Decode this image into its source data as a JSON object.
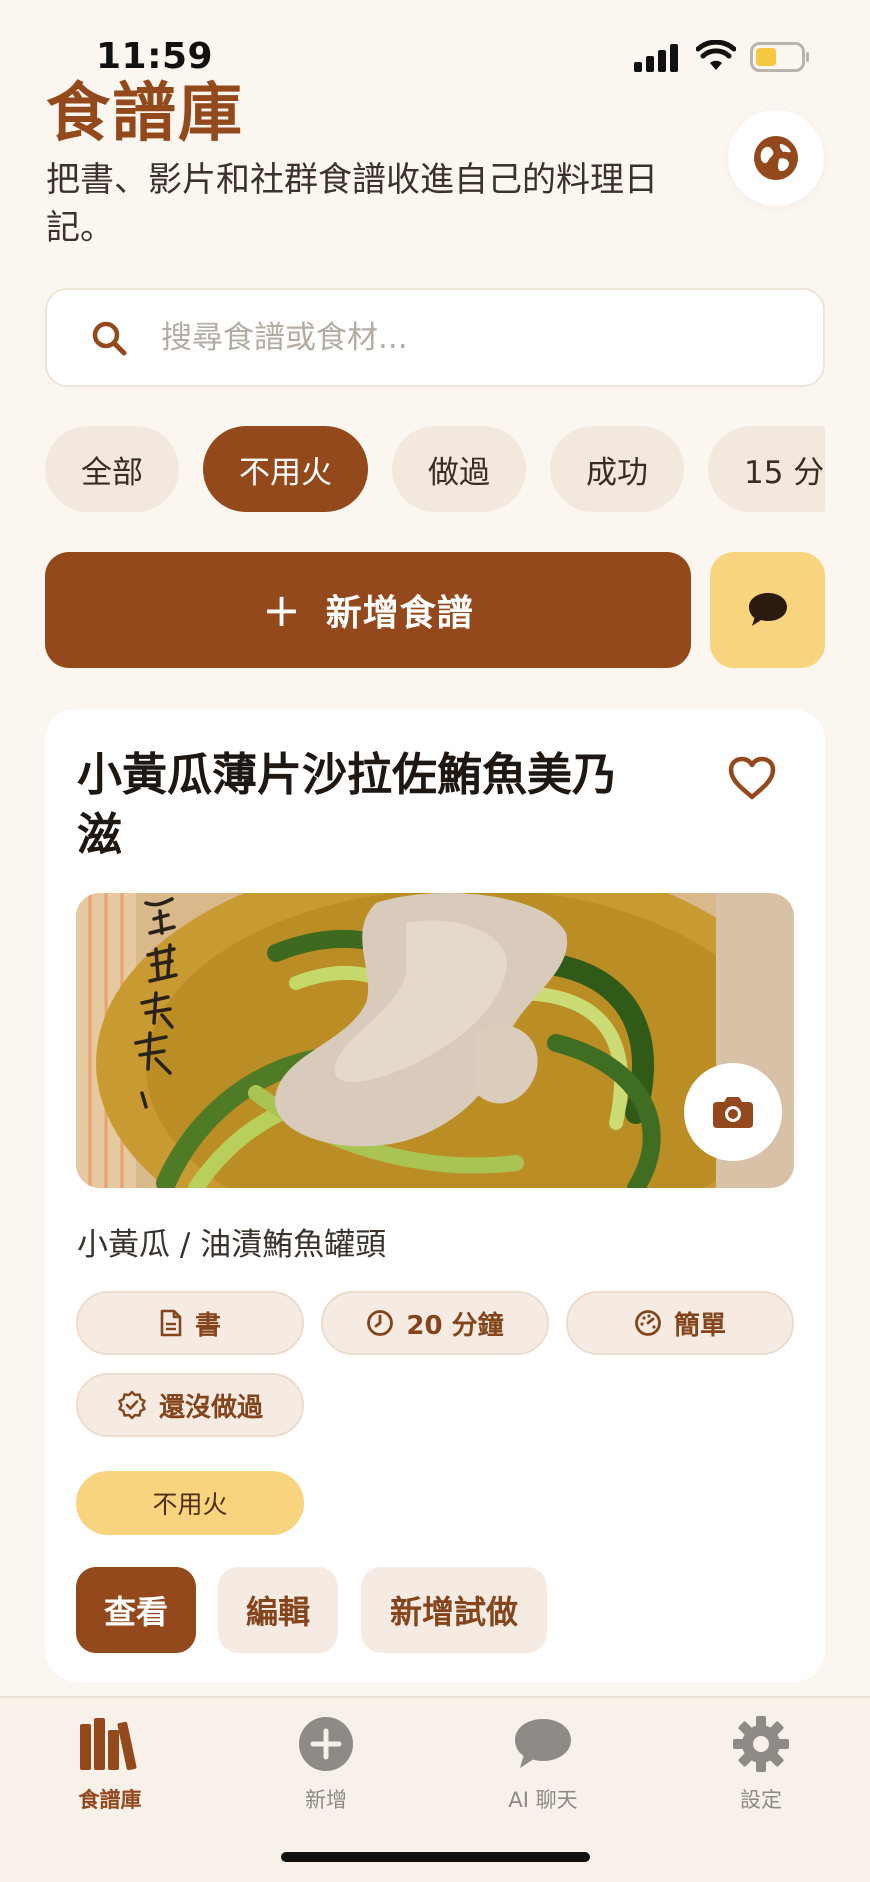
{
  "status_bar": {
    "time": "11:59"
  },
  "header": {
    "title": "食譜庫",
    "subtitle": "把書、影片和社群食譜收進自己的料理日記。"
  },
  "search": {
    "placeholder": "搜尋食譜或食材..."
  },
  "filters": {
    "chips": [
      {
        "label": "全部",
        "active": false
      },
      {
        "label": "不用火",
        "active": true
      },
      {
        "label": "做過",
        "active": false
      },
      {
        "label": "成功",
        "active": false
      },
      {
        "label": "15 分",
        "active": false
      }
    ]
  },
  "actions": {
    "add_label": "新增食譜",
    "add_icon": "plus-icon",
    "chat_icon": "chat-bubble-icon"
  },
  "recipe": {
    "title": "小黃瓜薄片沙拉佐鮪魚美乃滋",
    "ingredients": "小黃瓜 / 油漬鮪魚罐頭",
    "meta": {
      "source": "書",
      "time": "20 分鐘",
      "difficulty": "簡單",
      "status": "還沒做過"
    },
    "tag": "不用火",
    "buttons": {
      "view": "查看",
      "edit": "編輯",
      "add_attempt": "新增試做"
    }
  },
  "tabbar": {
    "items": [
      {
        "label": "食譜庫",
        "icon": "books-icon",
        "active": true
      },
      {
        "label": "新增",
        "icon": "plus-circle-icon",
        "active": false
      },
      {
        "label": "AI 聊天",
        "icon": "chat-bubble-icon",
        "active": false
      },
      {
        "label": "設定",
        "icon": "gear-icon",
        "active": false
      }
    ]
  },
  "colors": {
    "brand": "#93491c",
    "accent_yellow": "#f8d47e",
    "background": "#fcf6f1",
    "chip_bg": "#f3e8dd"
  }
}
